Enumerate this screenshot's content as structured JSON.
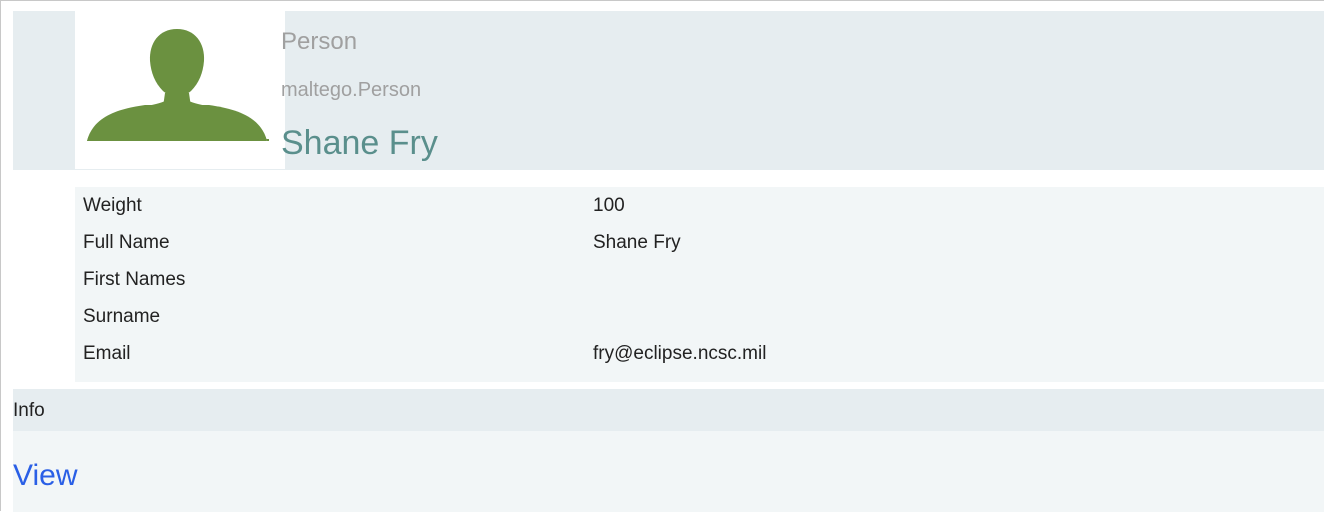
{
  "entity": {
    "type_label": "Person",
    "type_id": "maltego.Person",
    "value": "Shane Fry",
    "icon": "person-icon",
    "icon_color": "#6b9140"
  },
  "properties": [
    {
      "name": "Weight",
      "value": "100"
    },
    {
      "name": "Full Name",
      "value": "Shane Fry"
    },
    {
      "name": "First Names",
      "value": ""
    },
    {
      "name": "Surname",
      "value": ""
    },
    {
      "name": "Email",
      "value": "fry@eclipse.ncsc.mil"
    }
  ],
  "info": {
    "label": "Info",
    "link_label": "View",
    "link_color": "#2a5fe6"
  },
  "colors": {
    "header_bg": "#e6edf0",
    "props_bg": "#f2f6f7",
    "value_text": "#5a8f8c"
  }
}
